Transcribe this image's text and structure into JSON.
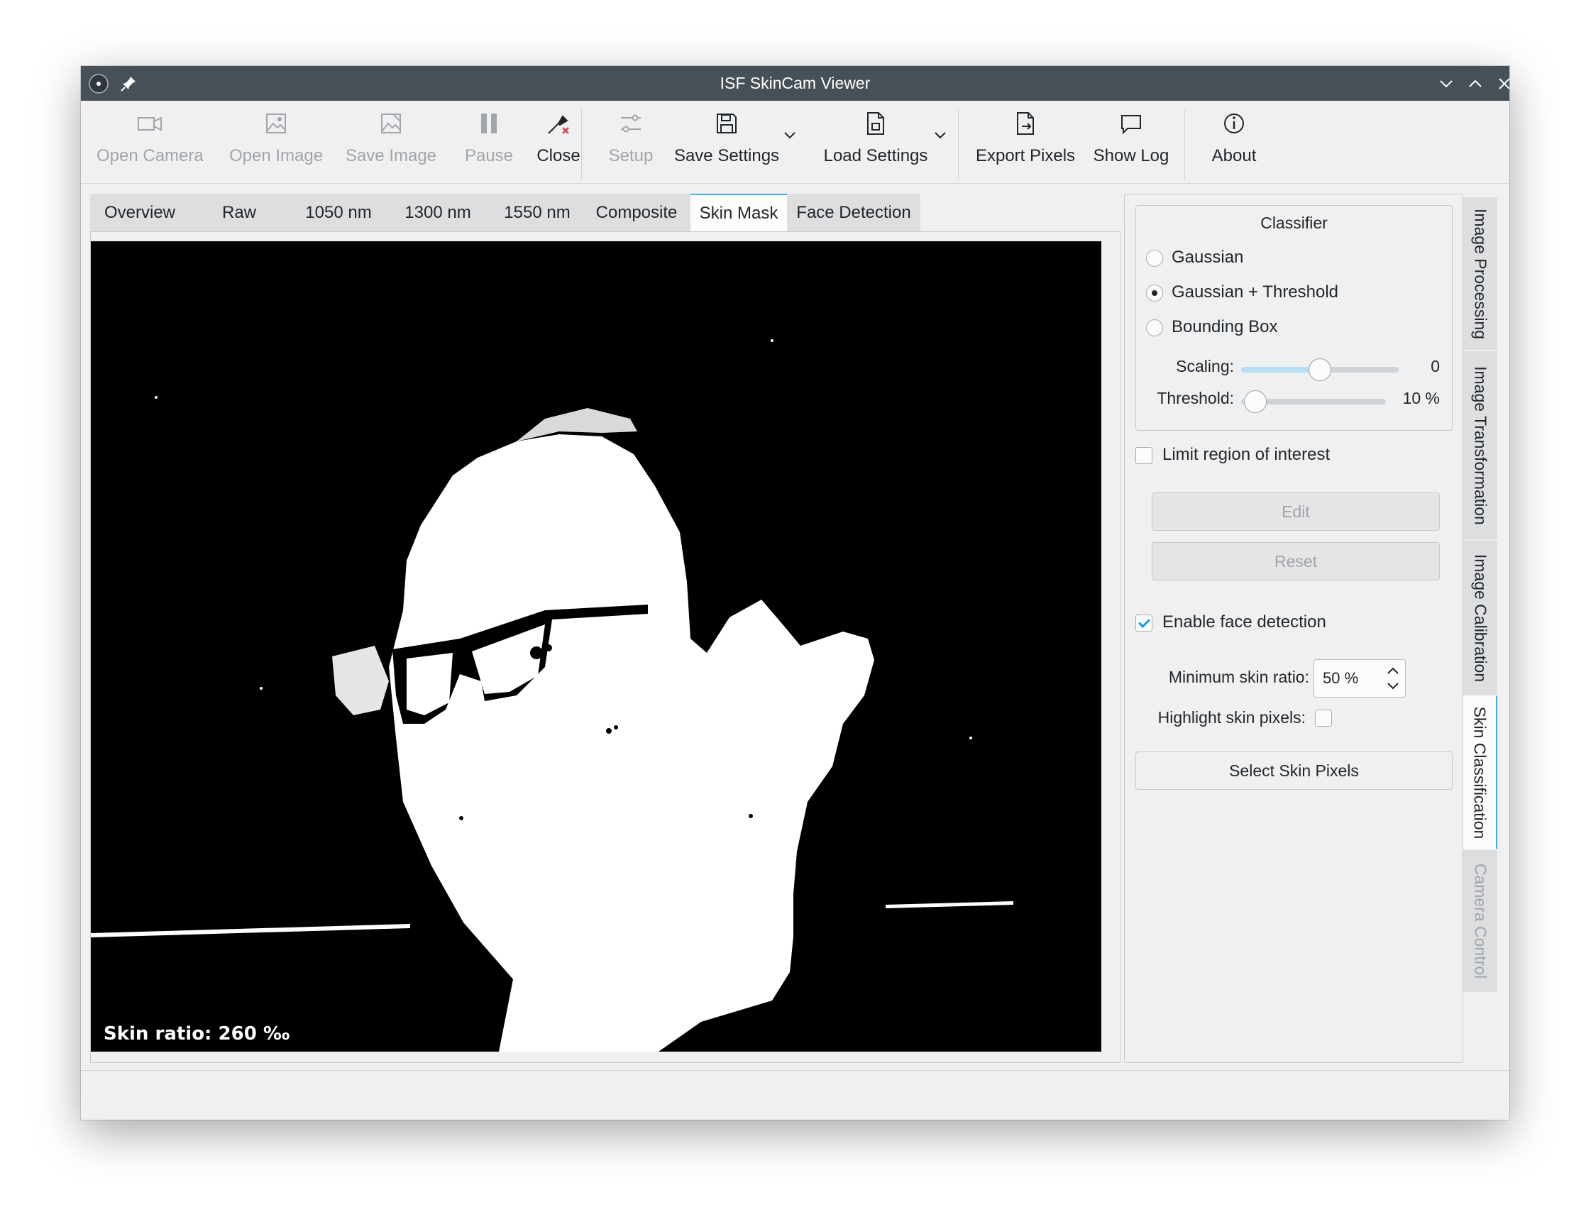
{
  "window": {
    "title": "ISF SkinCam Viewer"
  },
  "toolbar": {
    "open_camera": "Open Camera",
    "open_image": "Open Image",
    "save_image": "Save Image",
    "pause": "Pause",
    "close": "Close",
    "setup": "Setup",
    "save_settings": "Save Settings",
    "load_settings": "Load Settings",
    "export_pixels": "Export Pixels",
    "show_log": "Show Log",
    "about": "About"
  },
  "tabs": [
    {
      "label": "Overview"
    },
    {
      "label": "Raw"
    },
    {
      "label": "1050 nm"
    },
    {
      "label": "1300 nm"
    },
    {
      "label": "1550 nm"
    },
    {
      "label": "Composite"
    },
    {
      "label": "Skin Mask"
    },
    {
      "label": "Face Detection"
    }
  ],
  "active_tab": "Skin Mask",
  "image": {
    "skin_ratio_text": "Skin ratio: 260 ‰"
  },
  "classifier": {
    "title": "Classifier",
    "options": [
      {
        "label": "Gaussian",
        "selected": false
      },
      {
        "label": "Gaussian + Threshold",
        "selected": true
      },
      {
        "label": "Bounding Box",
        "selected": false
      }
    ],
    "scaling_label": "Scaling:",
    "scaling_value": "0",
    "scaling_fraction": 0.5,
    "threshold_label": "Threshold:",
    "threshold_value": "10 %",
    "threshold_fraction": 0.1
  },
  "roi": {
    "limit_label": "Limit region of interest",
    "limit_checked": false,
    "edit_label": "Edit",
    "reset_label": "Reset"
  },
  "face_detection": {
    "enable_label": "Enable face detection",
    "enabled": true,
    "min_ratio_label": "Minimum skin ratio:",
    "min_ratio_value": "50 %",
    "highlight_label": "Highlight skin pixels:",
    "highlight_checked": false,
    "select_button": "Select Skin Pixels"
  },
  "side_tabs": [
    {
      "label": "Image Processing",
      "state": "normal"
    },
    {
      "label": "Image Transformation",
      "state": "normal"
    },
    {
      "label": "Image Calibration",
      "state": "normal"
    },
    {
      "label": "Skin Classification",
      "state": "active"
    },
    {
      "label": "Camera Control",
      "state": "disabled"
    }
  ],
  "colors": {
    "accent": "#3daee9",
    "titlebar": "#475057",
    "window_bg": "#eff0f1"
  }
}
